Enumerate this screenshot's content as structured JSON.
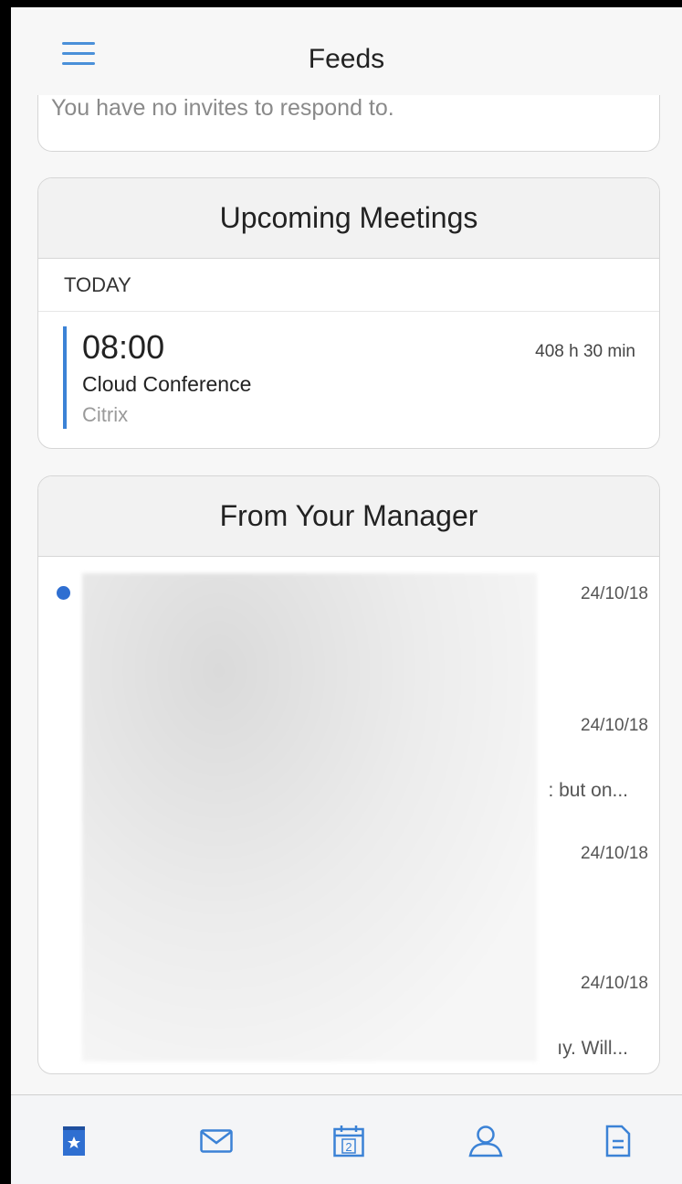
{
  "header": {
    "title": "Feeds",
    "menu_icon": "hamburger-menu-icon"
  },
  "invites": {
    "empty_text": "You have no invites to respond to."
  },
  "meetings": {
    "title": "Upcoming Meetings",
    "section": "TODAY",
    "items": [
      {
        "time": "08:00",
        "title": "Cloud Conference",
        "organizer": "Citrix",
        "duration": "408 h 30 min"
      }
    ]
  },
  "manager": {
    "title": "From Your Manager",
    "messages": [
      {
        "date": "24/10/18",
        "snippet": "",
        "unread": true
      },
      {
        "date": "24/10/18",
        "snippet": ": but on...",
        "unread": false
      },
      {
        "date": "24/10/18",
        "snippet": "",
        "unread": false
      },
      {
        "date": "24/10/18",
        "snippet": "ıy. Will...",
        "unread": false
      }
    ]
  },
  "tabbar": {
    "tabs": [
      {
        "icon": "feeds-icon",
        "active": true
      },
      {
        "icon": "mail-icon",
        "active": false
      },
      {
        "icon": "calendar-icon",
        "calendar_day": "2",
        "active": false
      },
      {
        "icon": "contacts-icon",
        "active": false
      },
      {
        "icon": "document-icon",
        "active": false
      }
    ]
  },
  "colors": {
    "accent": "#3b82d6",
    "header_bg": "#f7f7f7"
  }
}
